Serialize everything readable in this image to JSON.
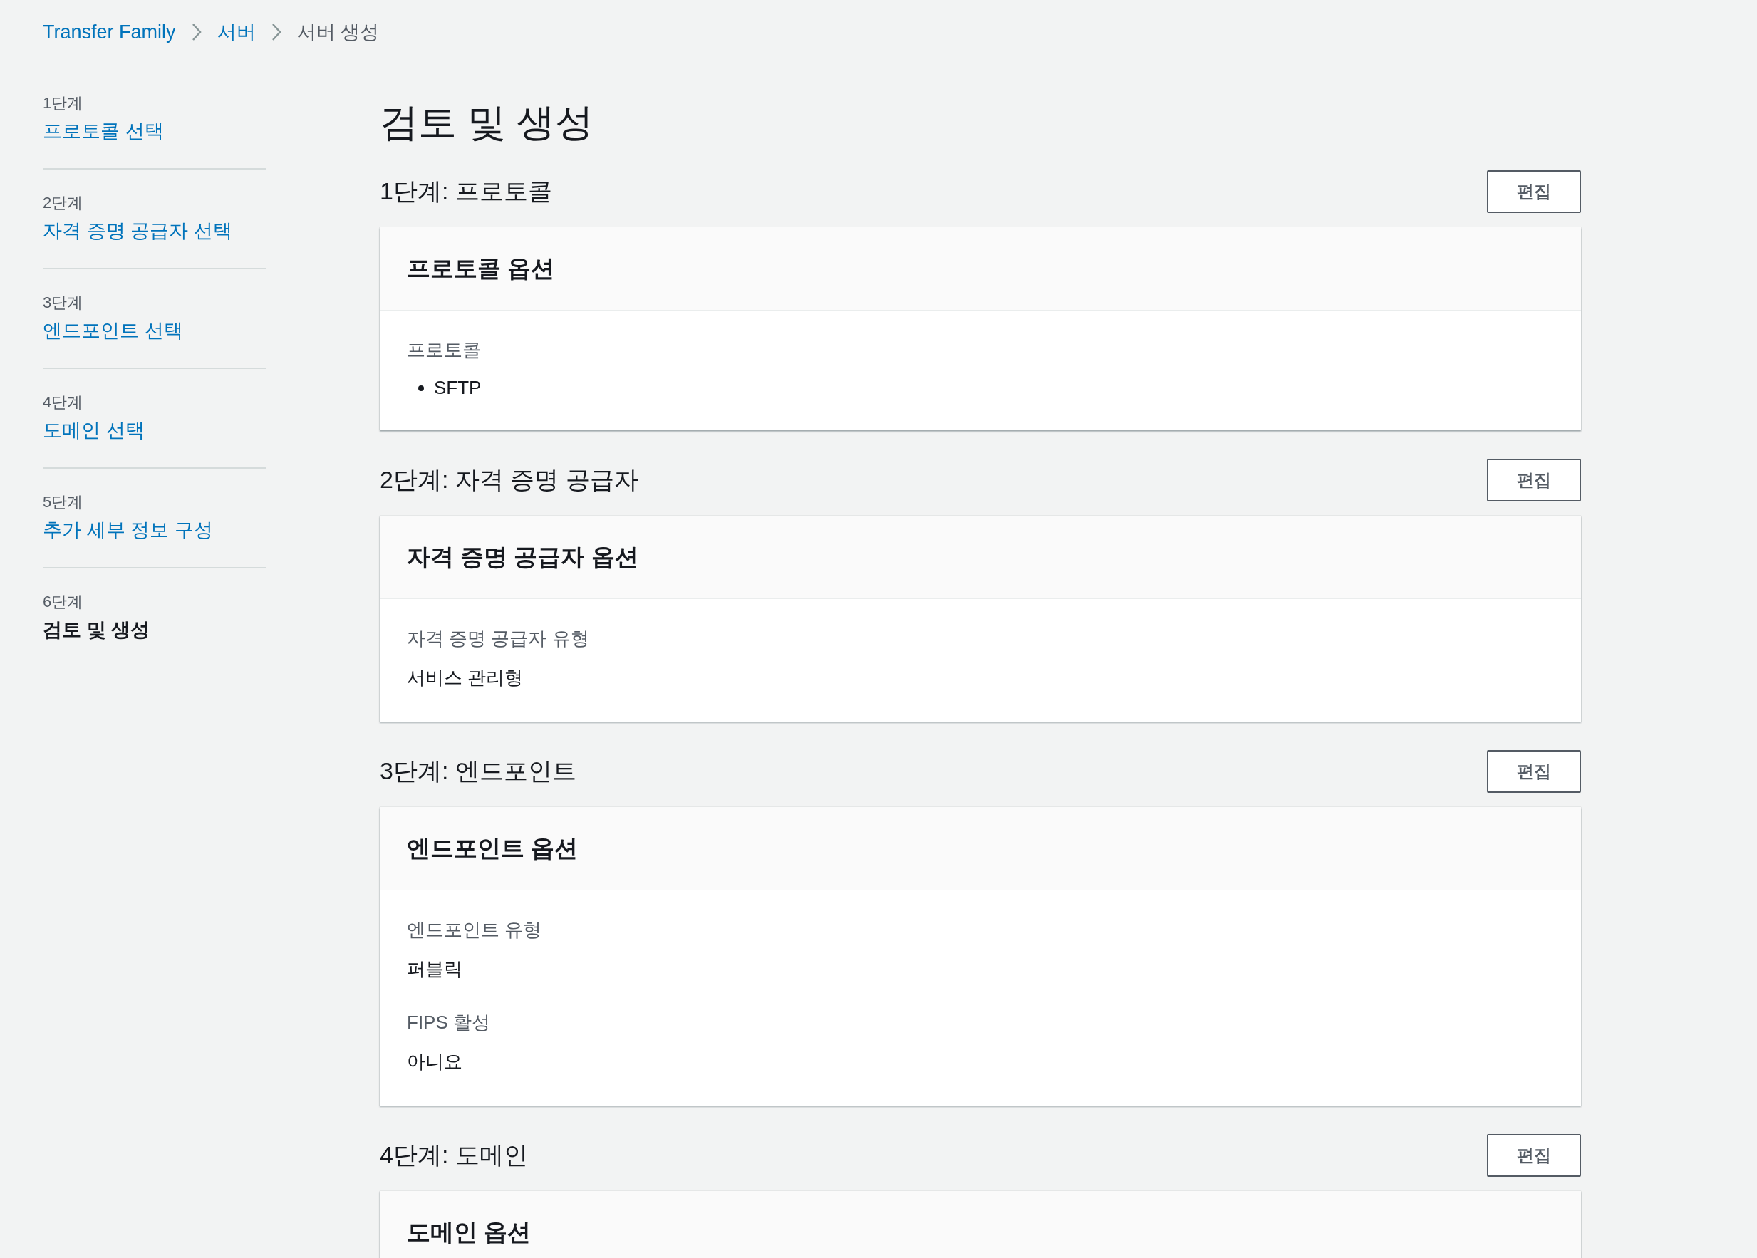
{
  "breadcrumbs": [
    {
      "label": "Transfer Family",
      "link": true
    },
    {
      "label": "서버",
      "link": true
    },
    {
      "label": "서버 생성",
      "link": false
    }
  ],
  "steps": [
    {
      "step": "1단계",
      "label": "프로토콜 선택",
      "selected": false
    },
    {
      "step": "2단계",
      "label": "자격 증명 공급자 선택",
      "selected": false
    },
    {
      "step": "3단계",
      "label": "엔드포인트 선택",
      "selected": false
    },
    {
      "step": "4단계",
      "label": "도메인 선택",
      "selected": false
    },
    {
      "step": "5단계",
      "label": "추가 세부 정보 구성",
      "selected": false
    },
    {
      "step": "6단계",
      "label": "검토 및 생성",
      "selected": true
    }
  ],
  "title": "검토 및 생성",
  "sections": [
    {
      "heading": "1단계: 프로토콜",
      "edit_button": "편집",
      "card_title": "프로토콜 옵션",
      "fields": [
        {
          "kind": "list",
          "label": "프로토콜",
          "items": [
            "SFTP"
          ]
        }
      ]
    },
    {
      "heading": "2단계: 자격 증명 공급자",
      "edit_button": "편집",
      "card_title": "자격 증명 공급자 옵션",
      "fields": [
        {
          "kind": "text",
          "label": "자격 증명 공급자 유형",
          "value": "서비스 관리형"
        }
      ]
    },
    {
      "heading": "3단계: 엔드포인트",
      "edit_button": "편집",
      "card_title": "엔드포인트 옵션",
      "fields": [
        {
          "kind": "text",
          "label": "엔드포인트 유형",
          "value": "퍼블릭"
        },
        {
          "kind": "text",
          "label": "FIPS 활성",
          "value": "아니요"
        }
      ]
    },
    {
      "heading": "4단계: 도메인",
      "edit_button": "편집",
      "card_title": "도메인 옵션"
    }
  ]
}
